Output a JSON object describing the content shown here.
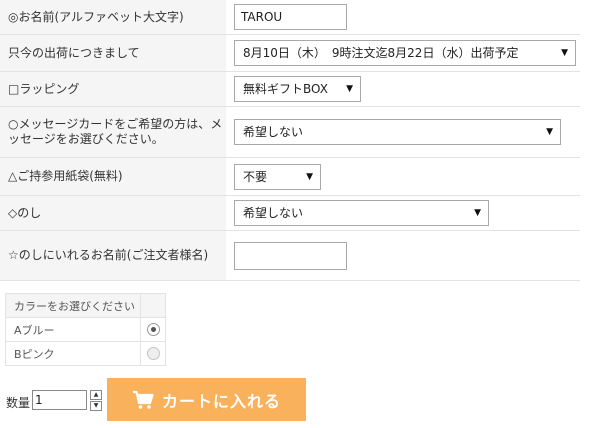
{
  "form": {
    "name": {
      "label": "◎お名前(アルファベット大文字)",
      "value": "TAROU"
    },
    "ship": {
      "label": "只今の出荷につきまして",
      "value": "8月10日（木）　9時注文迄8月22日（水）出荷予定"
    },
    "wrapping": {
      "label": "□ラッピング",
      "value": "無料ギフトBOX"
    },
    "message": {
      "label": "○メッセージカードをご希望の方は、メッセージをお選びください。",
      "value": "希望しない"
    },
    "bag": {
      "label": "△ご持参用紙袋(無料)",
      "value": "不要"
    },
    "noshi": {
      "label": "◇のし",
      "value": "希望しない"
    },
    "noshi_name": {
      "label": "☆のしにいれるお名前(ご注文者様名)",
      "value": ""
    }
  },
  "color": {
    "header": "カラーをお選びください",
    "options": [
      {
        "label": "Aブルー",
        "checked": true
      },
      {
        "label": "Bピンク",
        "checked": false
      }
    ]
  },
  "quantity": {
    "label": "数量",
    "value": "1"
  },
  "cart_button": {
    "label": "カートに入れる"
  },
  "colors": {
    "button": "#f9b15b",
    "label_bg": "#f5f5f5",
    "border": "#e3e3e3"
  },
  "icons": {
    "cart": "cart-icon",
    "dropdown": "chevron-down-icon"
  }
}
